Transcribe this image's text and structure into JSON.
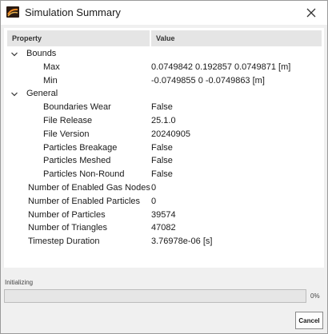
{
  "window": {
    "title": "Simulation Summary",
    "app_icon": "rocky-app-icon",
    "close_icon": "close-icon"
  },
  "table": {
    "headers": {
      "property": "Property",
      "value": "Value"
    },
    "rows": [
      {
        "key": "Bounds",
        "value": "",
        "level": 0,
        "expandable": true,
        "expanded": true
      },
      {
        "key": "Max",
        "value": "0.0749842 0.192857 0.0749871 [m]",
        "level": 2
      },
      {
        "key": "Min",
        "value": "-0.0749855 0 -0.0749863 [m]",
        "level": 2
      },
      {
        "key": "General",
        "value": "",
        "level": 0,
        "expandable": true,
        "expanded": true
      },
      {
        "key": "Boundaries Wear",
        "value": "False",
        "level": 2
      },
      {
        "key": "File Release",
        "value": "25.1.0",
        "level": 2
      },
      {
        "key": "File Version",
        "value": "20240905",
        "level": 2
      },
      {
        "key": "Particles Breakage",
        "value": "False",
        "level": 2
      },
      {
        "key": "Particles Meshed",
        "value": "False",
        "level": 2
      },
      {
        "key": "Particles Non-Round",
        "value": "False",
        "level": 2
      },
      {
        "key": "Number of Enabled Gas Nodes",
        "value": "0",
        "level": 1
      },
      {
        "key": "Number of Enabled Particles",
        "value": "0",
        "level": 1
      },
      {
        "key": "Number of Particles",
        "value": "39574",
        "level": 1
      },
      {
        "key": "Number of Triangles",
        "value": "47082",
        "level": 1
      },
      {
        "key": "Timestep Duration",
        "value": "3.76978e-06 [s]",
        "level": 1
      }
    ]
  },
  "status": {
    "label": "Initializing",
    "progress_percent": 0,
    "progress_text": "0%"
  },
  "buttons": {
    "cancel": "Cancel"
  },
  "colors": {
    "dialog_bg": "#f0f0f0",
    "panel_bg": "#ffffff",
    "header_bg": "#e5e5e5",
    "progress_fill": "#3a8ee6"
  }
}
